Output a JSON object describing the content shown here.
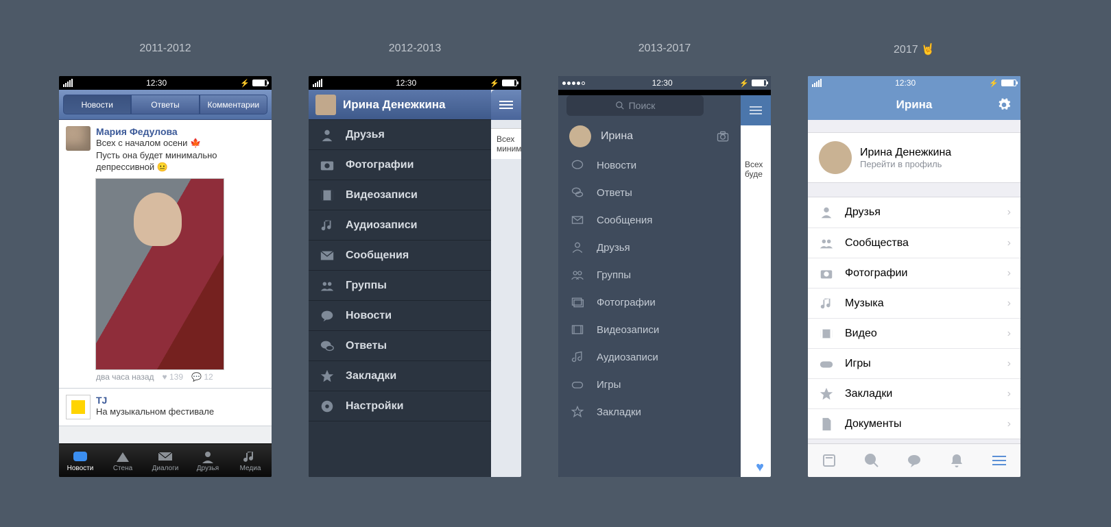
{
  "captions": {
    "c1": "2011-2012",
    "c2": "2012-2013",
    "c3": "2013-2017",
    "c4": "2017 🤘"
  },
  "status_time": "12:30",
  "phone1": {
    "segments": [
      "Новости",
      "Ответы",
      "Комментарии"
    ],
    "post": {
      "author": "Мария Федулова",
      "line1": "Всех с началом осени 🍁",
      "line2": "Пусть она будет минимально депрессивной 😐",
      "meta_time": "два часа назад",
      "likes": "139",
      "comments": "12"
    },
    "post2": {
      "author": "TJ",
      "text": "На музыкальном фестивале"
    },
    "tabs": [
      "Новости",
      "Стена",
      "Диалоги",
      "Друзья",
      "Медиа"
    ]
  },
  "phone2": {
    "name": "Ирина Денежкина",
    "items": [
      "Друзья",
      "Фотографии",
      "Видеозаписи",
      "Аудиозаписи",
      "Сообщения",
      "Группы",
      "Новости",
      "Ответы",
      "Закладки",
      "Настройки"
    ],
    "peek1": "Всех",
    "peek2": "миним"
  },
  "phone3": {
    "search_placeholder": "Поиск",
    "profile": "Ирина",
    "items": [
      "Новости",
      "Ответы",
      "Сообщения",
      "Друзья",
      "Группы",
      "Фотографии",
      "Видеозаписи",
      "Аудиозаписи",
      "Игры",
      "Закладки"
    ],
    "peek1": "Всех",
    "peek2": "буде"
  },
  "phone4": {
    "title": "Ирина",
    "profile_name": "Ирина Денежкина",
    "profile_sub": "Перейти в профиль",
    "items": [
      "Друзья",
      "Сообщества",
      "Фотографии",
      "Музыка",
      "Видео",
      "Игры",
      "Закладки",
      "Документы"
    ]
  }
}
